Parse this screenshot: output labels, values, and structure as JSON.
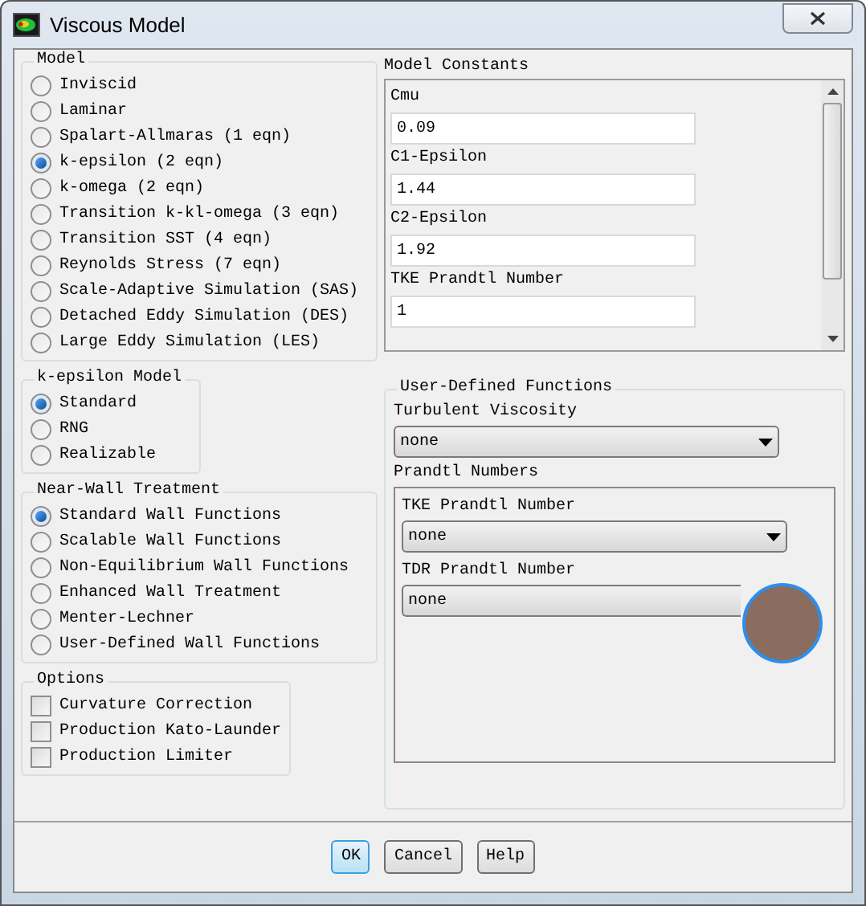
{
  "window": {
    "title": "Viscous Model"
  },
  "model": {
    "title": "Model",
    "options": [
      {
        "label": "Inviscid",
        "selected": false
      },
      {
        "label": "Laminar",
        "selected": false
      },
      {
        "label": "Spalart-Allmaras (1 eqn)",
        "selected": false
      },
      {
        "label": "k-epsilon (2 eqn)",
        "selected": true
      },
      {
        "label": "k-omega (2 eqn)",
        "selected": false
      },
      {
        "label": "Transition k-kl-omega (3 eqn)",
        "selected": false
      },
      {
        "label": "Transition SST (4 eqn)",
        "selected": false
      },
      {
        "label": "Reynolds Stress (7 eqn)",
        "selected": false
      },
      {
        "label": "Scale-Adaptive Simulation (SAS)",
        "selected": false
      },
      {
        "label": "Detached Eddy Simulation (DES)",
        "selected": false
      },
      {
        "label": "Large Eddy Simulation (LES)",
        "selected": false
      }
    ]
  },
  "k_epsilon_model": {
    "title": "k-epsilon Model",
    "options": [
      {
        "label": "Standard",
        "selected": true
      },
      {
        "label": "RNG",
        "selected": false
      },
      {
        "label": "Realizable",
        "selected": false
      }
    ]
  },
  "near_wall_treatment": {
    "title": "Near-Wall Treatment",
    "options": [
      {
        "label": "Standard Wall Functions",
        "selected": true
      },
      {
        "label": "Scalable Wall Functions",
        "selected": false
      },
      {
        "label": "Non-Equilibrium Wall Functions",
        "selected": false
      },
      {
        "label": "Enhanced Wall Treatment",
        "selected": false
      },
      {
        "label": "Menter-Lechner",
        "selected": false
      },
      {
        "label": "User-Defined Wall Functions",
        "selected": false
      }
    ]
  },
  "options": {
    "title": "Options",
    "items": [
      {
        "label": "Curvature Correction",
        "checked": false
      },
      {
        "label": "Production Kato-Launder",
        "checked": false
      },
      {
        "label": "Production Limiter",
        "checked": false
      }
    ]
  },
  "model_constants": {
    "title": "Model Constants",
    "fields": [
      {
        "label": "Cmu",
        "value": "0.09"
      },
      {
        "label": "C1-Epsilon",
        "value": "1.44"
      },
      {
        "label": "C2-Epsilon",
        "value": "1.92"
      },
      {
        "label": "TKE Prandtl Number",
        "value": "1"
      }
    ]
  },
  "user_defined_functions": {
    "title": "User-Defined Functions",
    "turbulent_viscosity": {
      "label": "Turbulent Viscosity",
      "value": "none"
    },
    "prandtl_numbers": {
      "title": "Prandtl Numbers",
      "fields": [
        {
          "label": "TKE Prandtl Number",
          "value": "none"
        },
        {
          "label": "TDR Prandtl Number",
          "value": "none"
        }
      ]
    }
  },
  "buttons": [
    {
      "label": "OK",
      "focused": true
    },
    {
      "label": "Cancel",
      "focused": false
    },
    {
      "label": "Help",
      "focused": false
    }
  ]
}
